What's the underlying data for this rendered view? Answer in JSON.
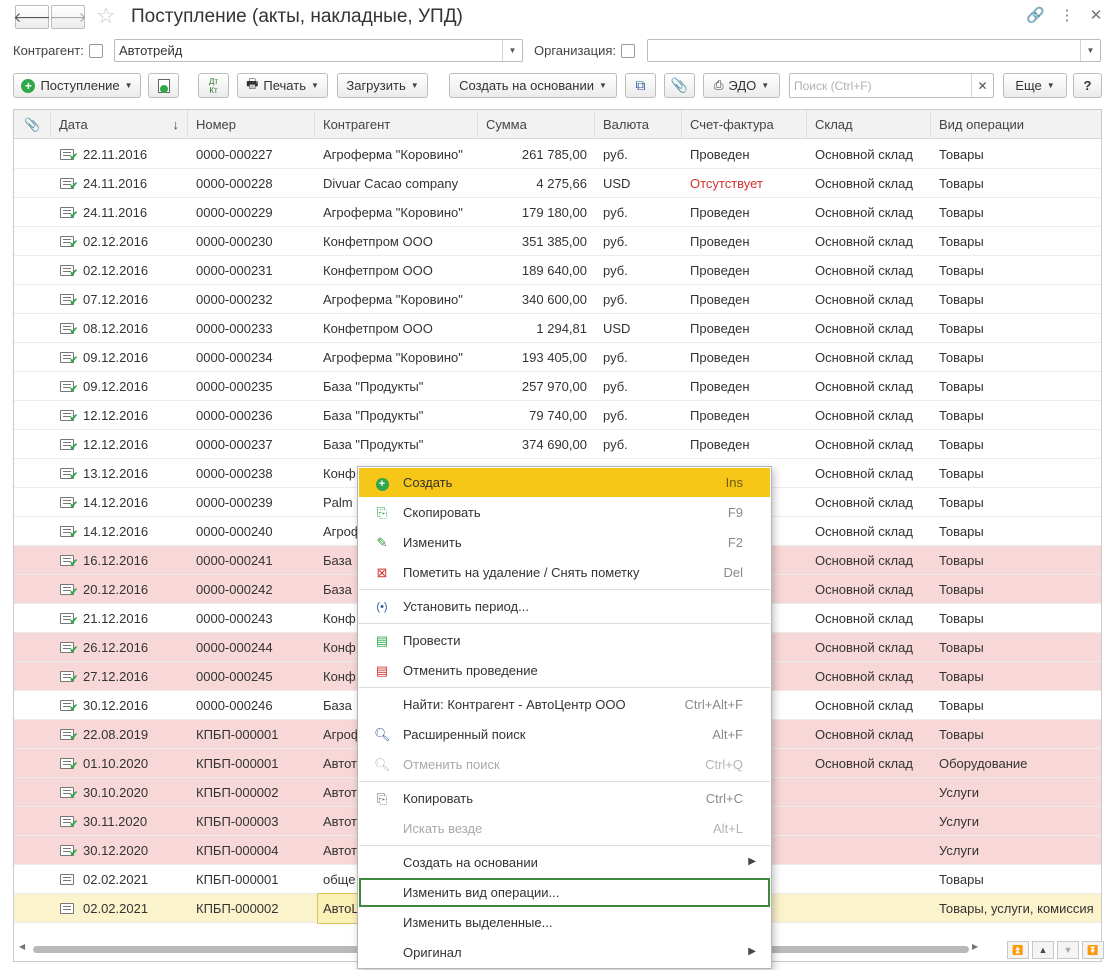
{
  "window": {
    "title": "Поступление (акты, накладные, УПД)"
  },
  "filters": {
    "counterparty_label": "Контрагент:",
    "counterparty_value": "Автотрейд",
    "organization_label": "Организация:",
    "organization_value": ""
  },
  "toolbar": {
    "receipt_label": "Поступление",
    "dtkt_label": "Дт Кт",
    "print_label": "Печать",
    "load_label": "Загрузить",
    "create_based_label": "Создать на основании",
    "edo_label": "ЭДО",
    "search_placeholder": "Поиск (Ctrl+F)",
    "more_label": "Еще",
    "help_label": "?"
  },
  "table": {
    "columns": [
      "Дата",
      "Номер",
      "Контрагент",
      "Сумма",
      "Валюта",
      "Счет-фактура",
      "Склад",
      "Вид операции"
    ],
    "rows": [
      {
        "date": "22.11.2016",
        "number": "0000-000227",
        "counterparty": "Агроферма \"Коровино\"",
        "sum": "261 785,00",
        "currency": "руб.",
        "invoice": "Проведен",
        "warehouse": "Основной склад",
        "operation": "Товары",
        "state": "normal"
      },
      {
        "date": "24.11.2016",
        "number": "0000-000228",
        "counterparty": "Divuar Cacao company",
        "sum": "4 275,66",
        "currency": "USD",
        "invoice": "Отсутствует",
        "warehouse": "Основной склад",
        "operation": "Товары",
        "state": "normal"
      },
      {
        "date": "24.11.2016",
        "number": "0000-000229",
        "counterparty": "Агроферма \"Коровино\"",
        "sum": "179 180,00",
        "currency": "руб.",
        "invoice": "Проведен",
        "warehouse": "Основной склад",
        "operation": "Товары",
        "state": "normal"
      },
      {
        "date": "02.12.2016",
        "number": "0000-000230",
        "counterparty": "Конфетпром ООО",
        "sum": "351 385,00",
        "currency": "руб.",
        "invoice": "Проведен",
        "warehouse": "Основной склад",
        "operation": "Товары",
        "state": "normal"
      },
      {
        "date": "02.12.2016",
        "number": "0000-000231",
        "counterparty": "Конфетпром ООО",
        "sum": "189 640,00",
        "currency": "руб.",
        "invoice": "Проведен",
        "warehouse": "Основной склад",
        "operation": "Товары",
        "state": "normal"
      },
      {
        "date": "07.12.2016",
        "number": "0000-000232",
        "counterparty": "Агроферма \"Коровино\"",
        "sum": "340 600,00",
        "currency": "руб.",
        "invoice": "Проведен",
        "warehouse": "Основной склад",
        "operation": "Товары",
        "state": "normal"
      },
      {
        "date": "08.12.2016",
        "number": "0000-000233",
        "counterparty": "Конфетпром ООО",
        "sum": "1 294,81",
        "currency": "USD",
        "invoice": "Проведен",
        "warehouse": "Основной склад",
        "operation": "Товары",
        "state": "normal"
      },
      {
        "date": "09.12.2016",
        "number": "0000-000234",
        "counterparty": "Агроферма \"Коровино\"",
        "sum": "193 405,00",
        "currency": "руб.",
        "invoice": "Проведен",
        "warehouse": "Основной склад",
        "operation": "Товары",
        "state": "normal"
      },
      {
        "date": "09.12.2016",
        "number": "0000-000235",
        "counterparty": "База \"Продукты\"",
        "sum": "257 970,00",
        "currency": "руб.",
        "invoice": "Проведен",
        "warehouse": "Основной склад",
        "operation": "Товары",
        "state": "normal"
      },
      {
        "date": "12.12.2016",
        "number": "0000-000236",
        "counterparty": "База \"Продукты\"",
        "sum": "79 740,00",
        "currency": "руб.",
        "invoice": "Проведен",
        "warehouse": "Основной склад",
        "operation": "Товары",
        "state": "normal"
      },
      {
        "date": "12.12.2016",
        "number": "0000-000237",
        "counterparty": "База \"Продукты\"",
        "sum": "374 690,00",
        "currency": "руб.",
        "invoice": "Проведен",
        "warehouse": "Основной склад",
        "operation": "Товары",
        "state": "normal"
      },
      {
        "date": "13.12.2016",
        "number": "0000-000238",
        "counterparty": "Конф",
        "sum": "",
        "currency": "",
        "invoice": "",
        "warehouse": "Основной склад",
        "operation": "Товары",
        "state": "normal"
      },
      {
        "date": "14.12.2016",
        "number": "0000-000239",
        "counterparty": "Palm",
        "sum": "",
        "currency": "",
        "invoice": "",
        "warehouse": "Основной склад",
        "operation": "Товары",
        "state": "normal"
      },
      {
        "date": "14.12.2016",
        "number": "0000-000240",
        "counterparty": "Агроф",
        "sum": "",
        "currency": "",
        "invoice": "",
        "warehouse": "Основной склад",
        "operation": "Товары",
        "state": "normal"
      },
      {
        "date": "16.12.2016",
        "number": "0000-000241",
        "counterparty": "База",
        "sum": "",
        "currency": "",
        "invoice": "",
        "warehouse": "Основной склад",
        "operation": "Товары",
        "state": "del"
      },
      {
        "date": "20.12.2016",
        "number": "0000-000242",
        "counterparty": "База",
        "sum": "",
        "currency": "",
        "invoice": "",
        "warehouse": "Основной склад",
        "operation": "Товары",
        "state": "del"
      },
      {
        "date": "21.12.2016",
        "number": "0000-000243",
        "counterparty": "Конф",
        "sum": "",
        "currency": "",
        "invoice": "",
        "warehouse": "Основной склад",
        "operation": "Товары",
        "state": "normal"
      },
      {
        "date": "26.12.2016",
        "number": "0000-000244",
        "counterparty": "Конф",
        "sum": "",
        "currency": "",
        "invoice": "",
        "warehouse": "Основной склад",
        "operation": "Товары",
        "state": "del"
      },
      {
        "date": "27.12.2016",
        "number": "0000-000245",
        "counterparty": "Конф",
        "sum": "",
        "currency": "",
        "invoice": "",
        "warehouse": "Основной склад",
        "operation": "Товары",
        "state": "del"
      },
      {
        "date": "30.12.2016",
        "number": "0000-000246",
        "counterparty": "База",
        "sum": "",
        "currency": "",
        "invoice": "",
        "warehouse": "Основной склад",
        "operation": "Товары",
        "state": "normal"
      },
      {
        "date": "22.08.2019",
        "number": "КПБП-000001",
        "counterparty": "Агроф",
        "sum": "",
        "currency": "",
        "invoice": "",
        "warehouse": "Основной склад",
        "operation": "Товары",
        "state": "del"
      },
      {
        "date": "01.10.2020",
        "number": "КПБП-000001",
        "counterparty": "Автот",
        "sum": "",
        "currency": "",
        "invoice": "",
        "warehouse": "Основной склад",
        "operation": "Оборудование",
        "state": "del"
      },
      {
        "date": "30.10.2020",
        "number": "КПБП-000002",
        "counterparty": "Автот",
        "sum": "",
        "currency": "",
        "invoice": "",
        "warehouse": "",
        "operation": "Услуги",
        "state": "del"
      },
      {
        "date": "30.11.2020",
        "number": "КПБП-000003",
        "counterparty": "Автот",
        "sum": "",
        "currency": "",
        "invoice": "",
        "warehouse": "",
        "operation": "Услуги",
        "state": "del"
      },
      {
        "date": "30.12.2020",
        "number": "КПБП-000004",
        "counterparty": "Автот",
        "sum": "",
        "currency": "",
        "invoice": "",
        "warehouse": "",
        "operation": "Услуги",
        "state": "del"
      },
      {
        "date": "02.02.2021",
        "number": "КПБП-000001",
        "counterparty": "обще",
        "sum": "",
        "currency": "",
        "invoice": "",
        "warehouse": "",
        "operation": "Товары",
        "state": "normal"
      },
      {
        "date": "02.02.2021",
        "number": "КПБП-000002",
        "counterparty": "АвтоЦ",
        "sum": "",
        "currency": "",
        "invoice": "",
        "warehouse": "",
        "operation": "Товары, услуги, комиссия",
        "state": "sel"
      }
    ]
  },
  "context_menu": {
    "items": [
      {
        "label": "Создать",
        "shortcut": "Ins",
        "icon": "add-icon"
      },
      {
        "label": "Скопировать",
        "shortcut": "F9",
        "icon": "copy-doc-icon"
      },
      {
        "label": "Изменить",
        "shortcut": "F2",
        "icon": "pencil-icon"
      },
      {
        "label": "Пометить на удаление / Снять пометку",
        "shortcut": "Del",
        "icon": "delete-mark-icon"
      },
      {
        "label": "Установить период...",
        "shortcut": "",
        "icon": "period-icon"
      },
      {
        "label": "Провести",
        "shortcut": "",
        "icon": "post-icon"
      },
      {
        "label": "Отменить проведение",
        "shortcut": "",
        "icon": "unpost-icon"
      },
      {
        "label": "Найти: Контрагент - АвтоЦентр ООО",
        "shortcut": "Ctrl+Alt+F",
        "icon": ""
      },
      {
        "label": "Расширенный поиск",
        "shortcut": "Alt+F",
        "icon": "search-icon"
      },
      {
        "label": "Отменить поиск",
        "shortcut": "Ctrl+Q",
        "icon": "cancel-search-icon"
      },
      {
        "label": "Копировать",
        "shortcut": "Ctrl+C",
        "icon": "clipboard-icon"
      },
      {
        "label": "Искать везде",
        "shortcut": "Alt+L",
        "icon": ""
      },
      {
        "label": "Создать на основании",
        "shortcut": "",
        "icon": ""
      },
      {
        "label": "Изменить вид операции...",
        "shortcut": "",
        "icon": ""
      },
      {
        "label": "Изменить выделенные...",
        "shortcut": "",
        "icon": ""
      },
      {
        "label": "Оригинал",
        "shortcut": "",
        "icon": ""
      }
    ]
  },
  "colors": {
    "highlight": "#f6c719",
    "deleted_row": "#f7d7d7",
    "selected_row": "#fbf3cc",
    "focus_outline": "#3d8a3d",
    "status_missing": "#d0322d"
  }
}
